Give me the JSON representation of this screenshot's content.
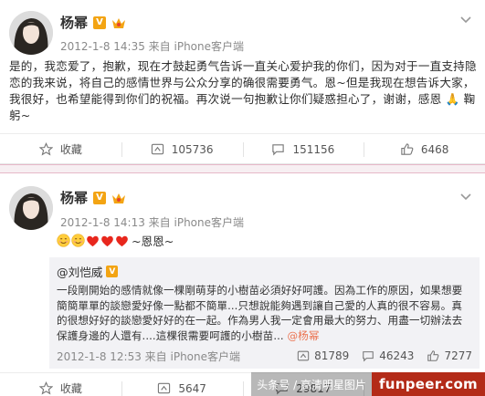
{
  "posts": [
    {
      "author": "杨幂",
      "verified_badge": "V",
      "meta": "2012-1-8 14:35 来自 iPhone客户端",
      "content": "是的，我恋爱了，抱歉，现在才鼓起勇气告诉一直关心爱护我的你们，因为对于一直支持隐恋的我来说，将自己的感情世界与公众分享的确很需要勇气。恩~但是我现在想告诉大家，我很好，也希望能得到你们的祝福。再次说一句抱歉让你们疑惑担心了，谢谢，感恩 🙏 鞠躬~",
      "actions": {
        "favorite": "收藏",
        "repost": "105736",
        "comment": "151156",
        "like": "6468"
      }
    },
    {
      "author": "杨幂",
      "verified_badge": "V",
      "meta": "2012-1-8 14:13 来自 iPhone客户端",
      "emoji_text": "~恩恩~",
      "repost": {
        "author": "@刘恺威",
        "verified_badge": "V",
        "text_before_mention": "一段剛開始的感情就像一棵剛萌芽的小樹苗必須好好呵護。因為工作的原因，如果想要簡簡單單的談戀愛好像一點都不簡單...只想說能夠遇到讓自己愛的人真的很不容易。真的很想好好的談戀愛好好的在一起。作為男人我一定會用最大的努力、用盡一切辦法去保護身邊的人還有....這棵很需要呵護的小樹苗... ",
        "mention": "@杨幂",
        "meta": "2012-1-8 12:53 来自 iPhone客户端",
        "repost_count": "81789",
        "comment_count": "46243",
        "like_count": "7277"
      },
      "actions": {
        "favorite": "收藏",
        "repost": "5647",
        "comment": "29817"
      }
    }
  ],
  "watermark": {
    "cn_text": "头条号 / 高清明星图片",
    "site": "funpeer.com"
  },
  "colors": {
    "accent_orange": "#eb7350",
    "badge_gold": "#f3a413",
    "divider_pink": "#e7b8c8",
    "watermark_red": "#b32b18"
  },
  "icons": [
    "crown-icon",
    "chevron-down-icon",
    "star-icon",
    "repost-icon",
    "comment-icon",
    "thumbs-up-icon",
    "smile-emoji-icon",
    "heart-emoji-icon"
  ]
}
